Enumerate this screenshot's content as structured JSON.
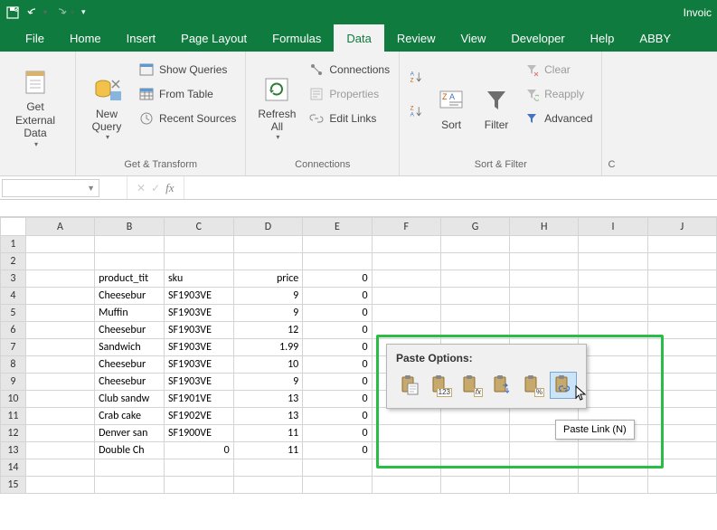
{
  "title": "Invoic",
  "tabs": [
    "File",
    "Home",
    "Insert",
    "Page Layout",
    "Formulas",
    "Data",
    "Review",
    "View",
    "Developer",
    "Help",
    "ABBY"
  ],
  "active_tab_index": 5,
  "ribbon": {
    "groups": [
      {
        "title": "",
        "big": [
          {
            "label": "Get External\nData",
            "drop": true
          }
        ]
      },
      {
        "title": "Get & Transform",
        "big": [
          {
            "label": "New\nQuery",
            "drop": true
          }
        ],
        "items": [
          "Show Queries",
          "From Table",
          "Recent Sources"
        ]
      },
      {
        "title": "Connections",
        "big": [
          {
            "label": "Refresh\nAll",
            "drop": true
          }
        ],
        "items": [
          "Connections",
          "Properties",
          "Edit Links"
        ]
      },
      {
        "title": "Sort & Filter",
        "big": [
          {
            "label": "Sort",
            "drop": false
          },
          {
            "label": "Filter",
            "drop": false
          }
        ],
        "items": [
          "Clear",
          "Reapply",
          "Advanced"
        ],
        "sort_buttons": [
          "A↓Z",
          "Z↓A"
        ]
      }
    ]
  },
  "namebox_value": "",
  "formula_value": "",
  "columns": [
    "A",
    "B",
    "C",
    "D",
    "E",
    "F",
    "G",
    "H",
    "I",
    "J"
  ],
  "rows": [
    1,
    2,
    3,
    4,
    5,
    6,
    7,
    8,
    9,
    10,
    11,
    12,
    13,
    14,
    15
  ],
  "data": {
    "B3": "product_tit",
    "C3": "sku",
    "D3": "price",
    "B4": "Cheesebur",
    "C4": "SF1903VE",
    "D4": "9",
    "B5": "Muffin",
    "C5": "SF1903VE",
    "D5": "9",
    "B6": "Cheesebur",
    "C6": "SF1903VE",
    "D6": "12",
    "B7": "Sandwich",
    "C7": "SF1903VE",
    "D7": "1.99",
    "B8": "Cheesebur",
    "C8": "SF1903VE",
    "D8": "10",
    "B9": "Cheesebur",
    "C9": "SF1903VE",
    "D9": "9",
    "B10": "Club sandw",
    "C10": "SF1901VE",
    "D10": "13",
    "B11": "Crab cake",
    "C11": "SF1902VE",
    "D11": "13",
    "B12": "Denver san",
    "C12": "SF1900VE",
    "D12": "11",
    "B13": "Double Ch",
    "C13": "0",
    "D13": "11",
    "E3": "0",
    "E4": "0",
    "E5": "0",
    "E6": "0",
    "E7": "0",
    "E8": "0",
    "E9": "0",
    "E10": "0",
    "E11": "0",
    "E12": "0",
    "E13": "0"
  },
  "popup": {
    "title": "Paste Options:",
    "icons": [
      "paste",
      "paste-values",
      "paste-formulas",
      "paste-transpose",
      "paste-formatting",
      "paste-link"
    ],
    "sub": [
      "",
      "123",
      "fx",
      "",
      "%",
      ""
    ],
    "hover_index": 5,
    "tooltip": "Paste Link (N)"
  }
}
